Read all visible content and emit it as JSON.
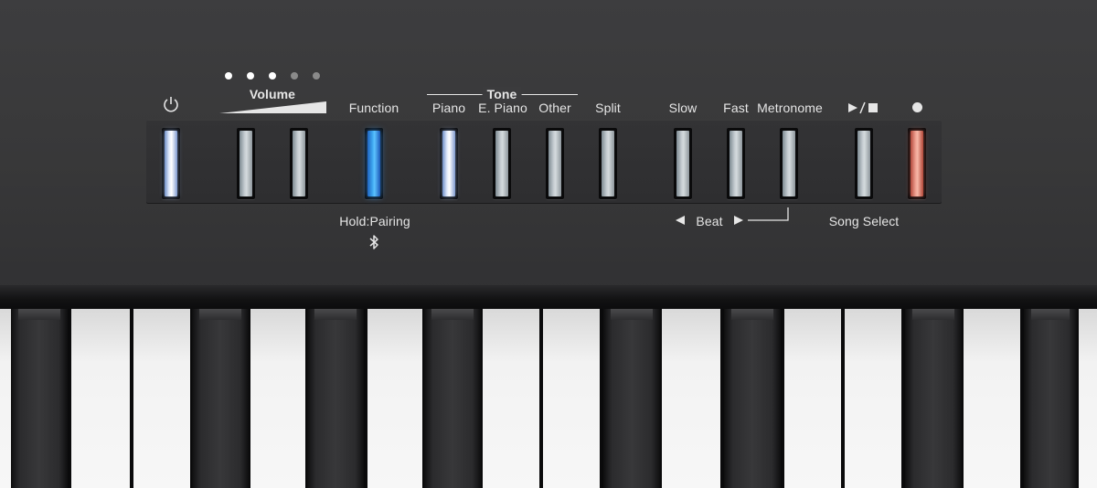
{
  "panel": {
    "volume": {
      "label": "Volume",
      "level_dots": [
        {
          "lit": true,
          "color": "#ffffff"
        },
        {
          "lit": true,
          "color": "#ffffff"
        },
        {
          "lit": true,
          "color": "#ffffff"
        },
        {
          "lit": false,
          "color": "#8a8a8a"
        },
        {
          "lit": false,
          "color": "#8a8a8a"
        }
      ]
    },
    "tone_group_label": "Tone",
    "labels": {
      "function": "Function",
      "piano": "Piano",
      "e_piano": "E. Piano",
      "other": "Other",
      "split": "Split",
      "slow": "Slow",
      "fast": "Fast",
      "metronome": "Metronome",
      "hold_pairing": "Hold:Pairing",
      "beat": "Beat",
      "song_select": "Song Select"
    },
    "icons": {
      "power": "power-icon",
      "play_stop": "play-stop-icon",
      "record": "record-icon",
      "bluetooth": "bluetooth-icon",
      "beat_left": "triangle-left-icon",
      "beat_right": "triangle-right-icon"
    },
    "button_states": {
      "power": "lit-white",
      "volume_down": "off",
      "volume_up": "off",
      "function": "lit-blue",
      "piano": "lit-white",
      "e_piano": "off",
      "other": "off",
      "split": "off",
      "slow": "off",
      "fast": "off",
      "metronome": "off",
      "play_stop": "off",
      "record": "lit-red"
    },
    "colors": {
      "panel": "#383839",
      "lit_white": "#ffffff",
      "lit_blue": "#3fa9f0",
      "lit_red": "#f0a192"
    }
  }
}
